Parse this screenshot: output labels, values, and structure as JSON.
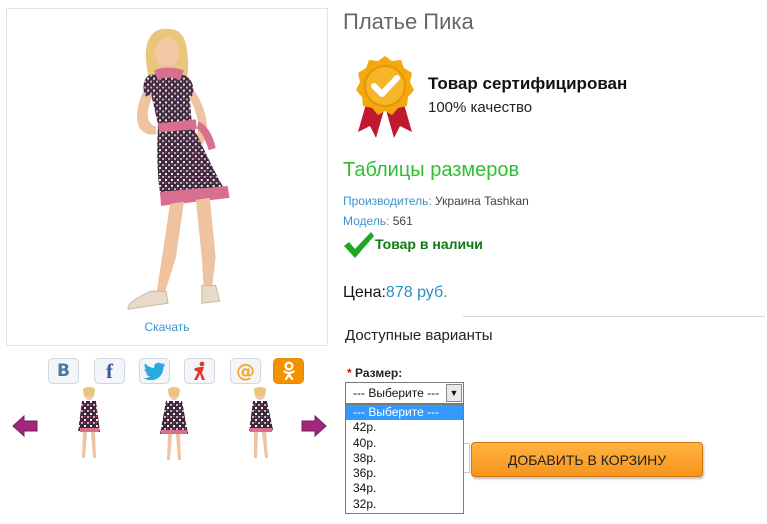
{
  "product": {
    "title": "Платье Пика",
    "download_label": "Скачать"
  },
  "certificate": {
    "title": "Товар сертифицирован",
    "subtitle": "100% качество",
    "badge_icon": "certified-badge-icon"
  },
  "size_table_label": "Таблицы размеров",
  "meta": {
    "manufacturer_key": "Производитель:",
    "manufacturer_value": " Украина Tashkan",
    "model_key": "Модель:",
    "model_value": " 561"
  },
  "stock": {
    "label": "Товар в наличи"
  },
  "price": {
    "label": "Цена:",
    "amount": "878 руб."
  },
  "variants": {
    "title": "Доступные варианты",
    "required_mark": "*",
    "size_label": " Размер:",
    "selected": "--- Выберите ---",
    "options": [
      "--- Выберите ---",
      "42р.",
      "40р.",
      "38р.",
      "36р.",
      "34р.",
      "32р."
    ]
  },
  "cart": {
    "add_label": "ДОБАВИТЬ В КОРЗИНУ"
  },
  "social": [
    {
      "icon": "vk-icon",
      "glyph": "В",
      "color": "#4a76a8"
    },
    {
      "icon": "facebook-icon",
      "glyph": "f",
      "color": "#3b5998"
    },
    {
      "icon": "twitter-icon",
      "glyph": "",
      "color": "#2aa9e0"
    },
    {
      "icon": "yaru-icon",
      "glyph": "",
      "color": "#e03a2e"
    },
    {
      "icon": "mailru-icon",
      "glyph": "@",
      "color": "#f5a623"
    },
    {
      "icon": "odnoklassniki-icon",
      "glyph": "",
      "color": "#f39200"
    }
  ],
  "colors": {
    "link_blue": "#3a94c8",
    "green_heading": "#2fbf2f",
    "stock_green": "#0f7a15",
    "dress_pink": "#d86f8f",
    "dress_dark": "#3b2a3d",
    "button_orange": "#f7951d",
    "arrow_purple": "#a0287a"
  }
}
